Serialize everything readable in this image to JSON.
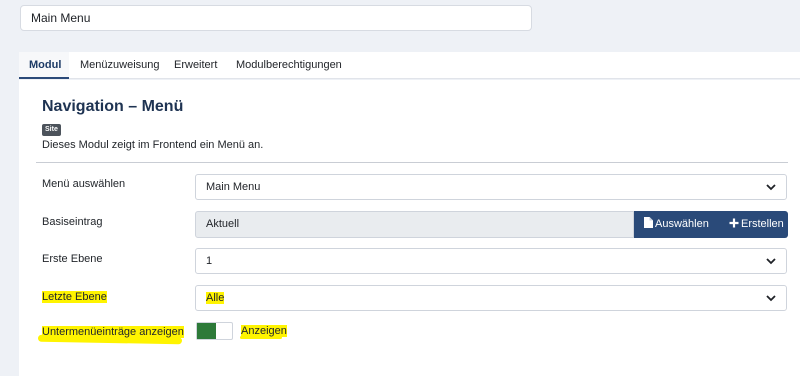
{
  "module_title_field": {
    "value": "Main Menu"
  },
  "tabs": [
    {
      "label": "Modul",
      "active": true
    },
    {
      "label": "Menüzuweisung",
      "active": false
    },
    {
      "label": "Erweitert",
      "active": false
    },
    {
      "label": "Modulberechtigungen",
      "active": false
    }
  ],
  "module": {
    "title": "Navigation – Menü",
    "badge": "Site",
    "description": "Dieses Modul zeigt im Frontend ein Menü an."
  },
  "fields": {
    "menu": {
      "label": "Menü auswählen",
      "value": "Main Menu"
    },
    "base": {
      "label": "Basiseintrag",
      "value": "Aktuell",
      "select_button": "Auswählen",
      "create_button": "Erstellen"
    },
    "start_level": {
      "label": "Erste Ebene",
      "value": "1"
    },
    "end_level": {
      "label": "Letzte Ebene",
      "value": "Alle"
    },
    "show_subitems": {
      "label": "Untermenüeinträge anzeigen",
      "value": "Anzeigen",
      "on": true
    }
  },
  "colors": {
    "primary": "#2a4a79",
    "toggle_on": "#2d7a39",
    "highlight": "#fff400"
  }
}
